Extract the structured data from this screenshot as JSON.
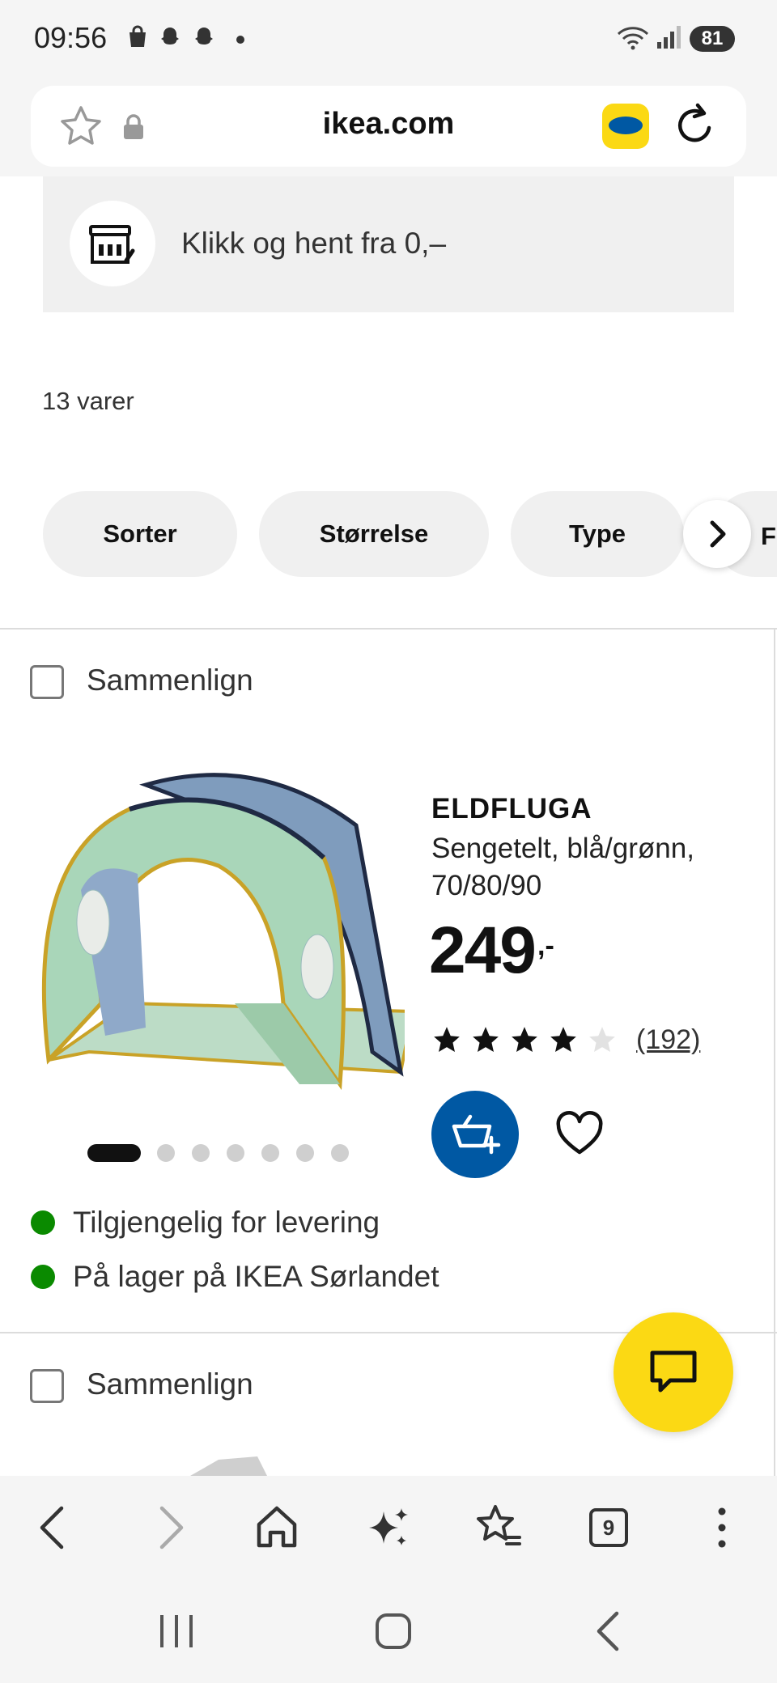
{
  "status_bar": {
    "time": "09:56",
    "battery": "81"
  },
  "browser": {
    "url": "ikea.com",
    "tab_count": "9"
  },
  "pickup_banner": {
    "text": "Klikk og hent fra 0,–"
  },
  "results": {
    "count": "13 varer"
  },
  "filters": [
    {
      "label": "Sorter"
    },
    {
      "label": "Størrelse"
    },
    {
      "label": "Type"
    },
    {
      "label": "F"
    }
  ],
  "product": {
    "compare_label": "Sammenlign",
    "name": "ELDFLUGA",
    "description": "Sengetelt, blå/grønn, 70/80/90",
    "price": "249",
    "price_suffix": ",-",
    "rating": 4,
    "rating_max": 5,
    "reviews": "(192)",
    "image_count": 7,
    "active_image": 1,
    "availability": [
      {
        "text": "Tilgjengelig for levering",
        "color": "#0a8a00"
      },
      {
        "text": "På lager på IKEA Sørlandet",
        "color": "#0a8a00"
      }
    ]
  },
  "next_product": {
    "compare_label": "Sammenlign"
  },
  "colors": {
    "ikea_blue": "#0058a3",
    "ikea_yellow": "#fbd914",
    "stock_green": "#0a8a00"
  }
}
